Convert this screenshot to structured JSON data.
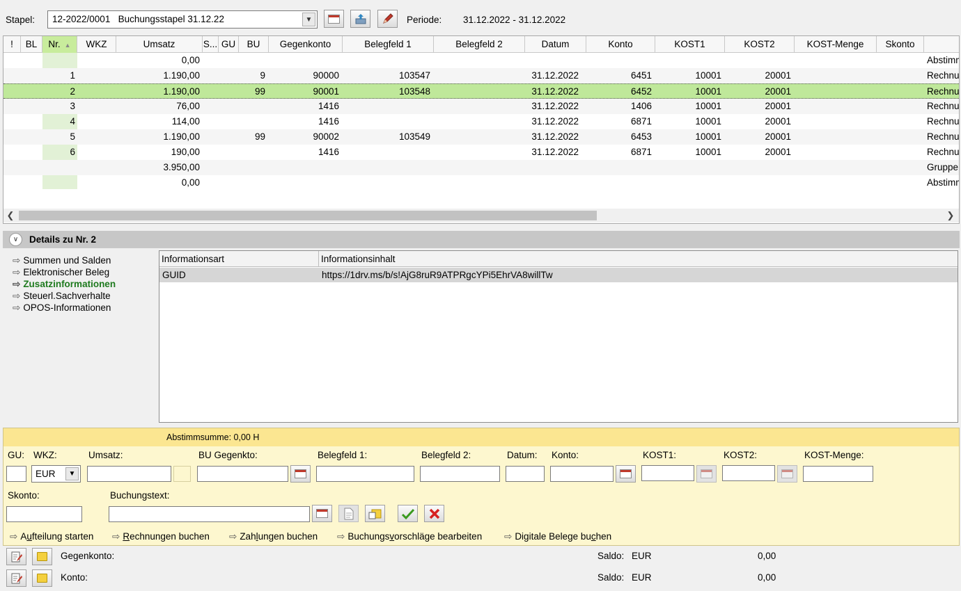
{
  "toolbar": {
    "stapel_label": "Stapel:",
    "stapel_value": "12-2022/0001   Buchungsstapel 31.12.22",
    "periode_label": "Periode:",
    "periode_value": "31.12.2022 - 31.12.2022"
  },
  "grid": {
    "columns": [
      "!",
      "BL",
      "Nr.",
      "WKZ",
      "Umsatz",
      "S...",
      "GU",
      "BU",
      "Gegenkonto",
      "Belegfeld 1",
      "Belegfeld 2",
      "Datum",
      "Konto",
      "KOST1",
      "KOST2",
      "KOST-Menge",
      "Skonto"
    ],
    "sorted_column": "Nr.",
    "rows": [
      {
        "nr": "",
        "umsatz": "0,00",
        "bu": "",
        "gegenkonto": "",
        "belegfeld1": "",
        "datum": "",
        "konto": "",
        "kost1": "",
        "kost2": "",
        "text": "Abstimm"
      },
      {
        "nr": "1",
        "umsatz": "1.190,00",
        "bu": "9",
        "gegenkonto": "90000",
        "belegfeld1": "103547",
        "datum": "31.12.2022",
        "konto": "6451",
        "kost1": "10001",
        "kost2": "20001",
        "text": "Rechnu"
      },
      {
        "nr": "2",
        "umsatz": "1.190,00",
        "bu": "99",
        "gegenkonto": "90001",
        "belegfeld1": "103548",
        "datum": "31.12.2022",
        "konto": "6452",
        "kost1": "10001",
        "kost2": "20001",
        "text": "Rechnu"
      },
      {
        "nr": "3",
        "umsatz": "76,00",
        "bu": "",
        "gegenkonto": "1416",
        "belegfeld1": "",
        "datum": "31.12.2022",
        "konto": "1406",
        "kost1": "10001",
        "kost2": "20001",
        "text": "Rechnu"
      },
      {
        "nr": "4",
        "umsatz": "114,00",
        "bu": "",
        "gegenkonto": "1416",
        "belegfeld1": "",
        "datum": "31.12.2022",
        "konto": "6871",
        "kost1": "10001",
        "kost2": "20001",
        "text": "Rechnu"
      },
      {
        "nr": "5",
        "umsatz": "1.190,00",
        "bu": "99",
        "gegenkonto": "90002",
        "belegfeld1": "103549",
        "datum": "31.12.2022",
        "konto": "6453",
        "kost1": "10001",
        "kost2": "20001",
        "text": "Rechnu"
      },
      {
        "nr": "6",
        "umsatz": "190,00",
        "bu": "",
        "gegenkonto": "1416",
        "belegfeld1": "",
        "datum": "31.12.2022",
        "konto": "6871",
        "kost1": "10001",
        "kost2": "20001",
        "text": "Rechnu"
      },
      {
        "nr": "",
        "umsatz": "3.950,00",
        "bu": "",
        "gegenkonto": "",
        "belegfeld1": "",
        "datum": "",
        "konto": "",
        "kost1": "",
        "kost2": "",
        "text": "Gruppe"
      },
      {
        "nr": "",
        "umsatz": "0,00",
        "bu": "",
        "gegenkonto": "",
        "belegfeld1": "",
        "datum": "",
        "konto": "",
        "kost1": "",
        "kost2": "",
        "text": "Abstimm"
      }
    ],
    "selected_index": 2
  },
  "details": {
    "title": "Details zu Nr. 2",
    "nav": [
      {
        "label": "Summen und Salden",
        "active": false
      },
      {
        "label": "Elektronischer Beleg",
        "active": false
      },
      {
        "label": "Zusatzinformationen",
        "active": true
      },
      {
        "label": "Steuerl.Sachverhalte",
        "active": false
      },
      {
        "label": "OPOS-Informationen",
        "active": false
      }
    ],
    "table_headers": [
      "Informationsart",
      "Informationsinhalt"
    ],
    "table_rows": [
      {
        "art": "GUID",
        "inhalt": "https://1drv.ms/b/s!AjG8ruR9ATPRgcYPi5EhrVA8willTw"
      }
    ]
  },
  "entry": {
    "abstimmsumme": "Abstimmsumme: 0,00 H",
    "labels": {
      "gu": "GU:",
      "wkz": "WKZ:",
      "umsatz": "Umsatz:",
      "bu_gegenkto": "BU Gegenkto:",
      "belegfeld1": "Belegfeld 1:",
      "belegfeld2": "Belegfeld 2:",
      "datum": "Datum:",
      "konto": "Konto:",
      "kost1": "KOST1:",
      "kost2": "KOST2:",
      "kost_menge": "KOST-Menge:",
      "skonto": "Skonto:",
      "buchungstext": "Buchungstext:"
    },
    "wkz_value": "EUR",
    "actions": [
      "Aufteilung starten",
      "Rechnungen buchen",
      "Zahlungen buchen",
      "Buchungsvorschläge bearbeiten",
      "Digitale Belege buchen"
    ],
    "action_mnemonics": [
      "u",
      "R",
      "l",
      "v",
      "c"
    ]
  },
  "footer": {
    "rows": [
      {
        "label": "Gegenkonto:",
        "saldo_label": "Saldo:",
        "currency": "EUR",
        "value": "0,00"
      },
      {
        "label": "Konto:",
        "saldo_label": "Saldo:",
        "currency": "EUR",
        "value": "0,00"
      }
    ]
  },
  "colors": {
    "selected_row": "#bfe89a",
    "sorted_header": "#c8ec9c",
    "entry_panel": "#fdf7cf",
    "entry_band": "#fbe691",
    "active_nav": "#1e7a1e"
  }
}
